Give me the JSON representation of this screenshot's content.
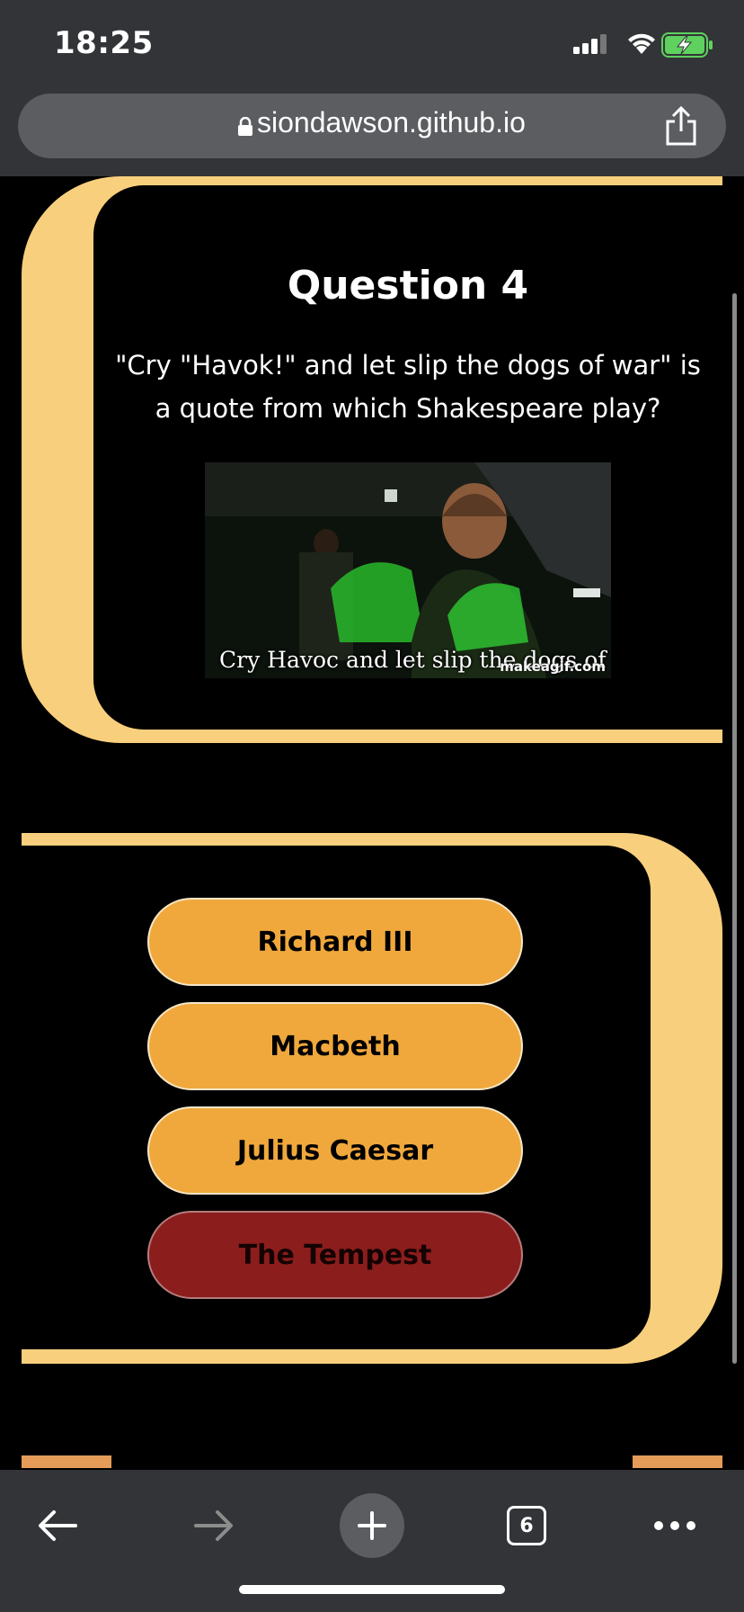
{
  "status_bar": {
    "time": "18:25"
  },
  "browser": {
    "url": "siondawson.github.io",
    "tab_count": "6"
  },
  "quiz": {
    "title": "Question 4",
    "question": "\"Cry \"Havok!\" and let slip the dogs of war\" is a quote from which Shakespeare play?",
    "image": {
      "caption": "Cry Havoc and let slip the dogs of war",
      "watermark": "makeagif.com"
    },
    "answers": [
      {
        "label": "Richard III",
        "state": "default"
      },
      {
        "label": "Macbeth",
        "state": "default"
      },
      {
        "label": "Julius Caesar",
        "state": "default"
      },
      {
        "label": "The Tempest",
        "state": "wrong"
      }
    ]
  },
  "colors": {
    "frame": "#f8cf7d",
    "answer_default": "#f0a83c",
    "answer_wrong": "#8b1d1d",
    "chrome": "#333437"
  }
}
